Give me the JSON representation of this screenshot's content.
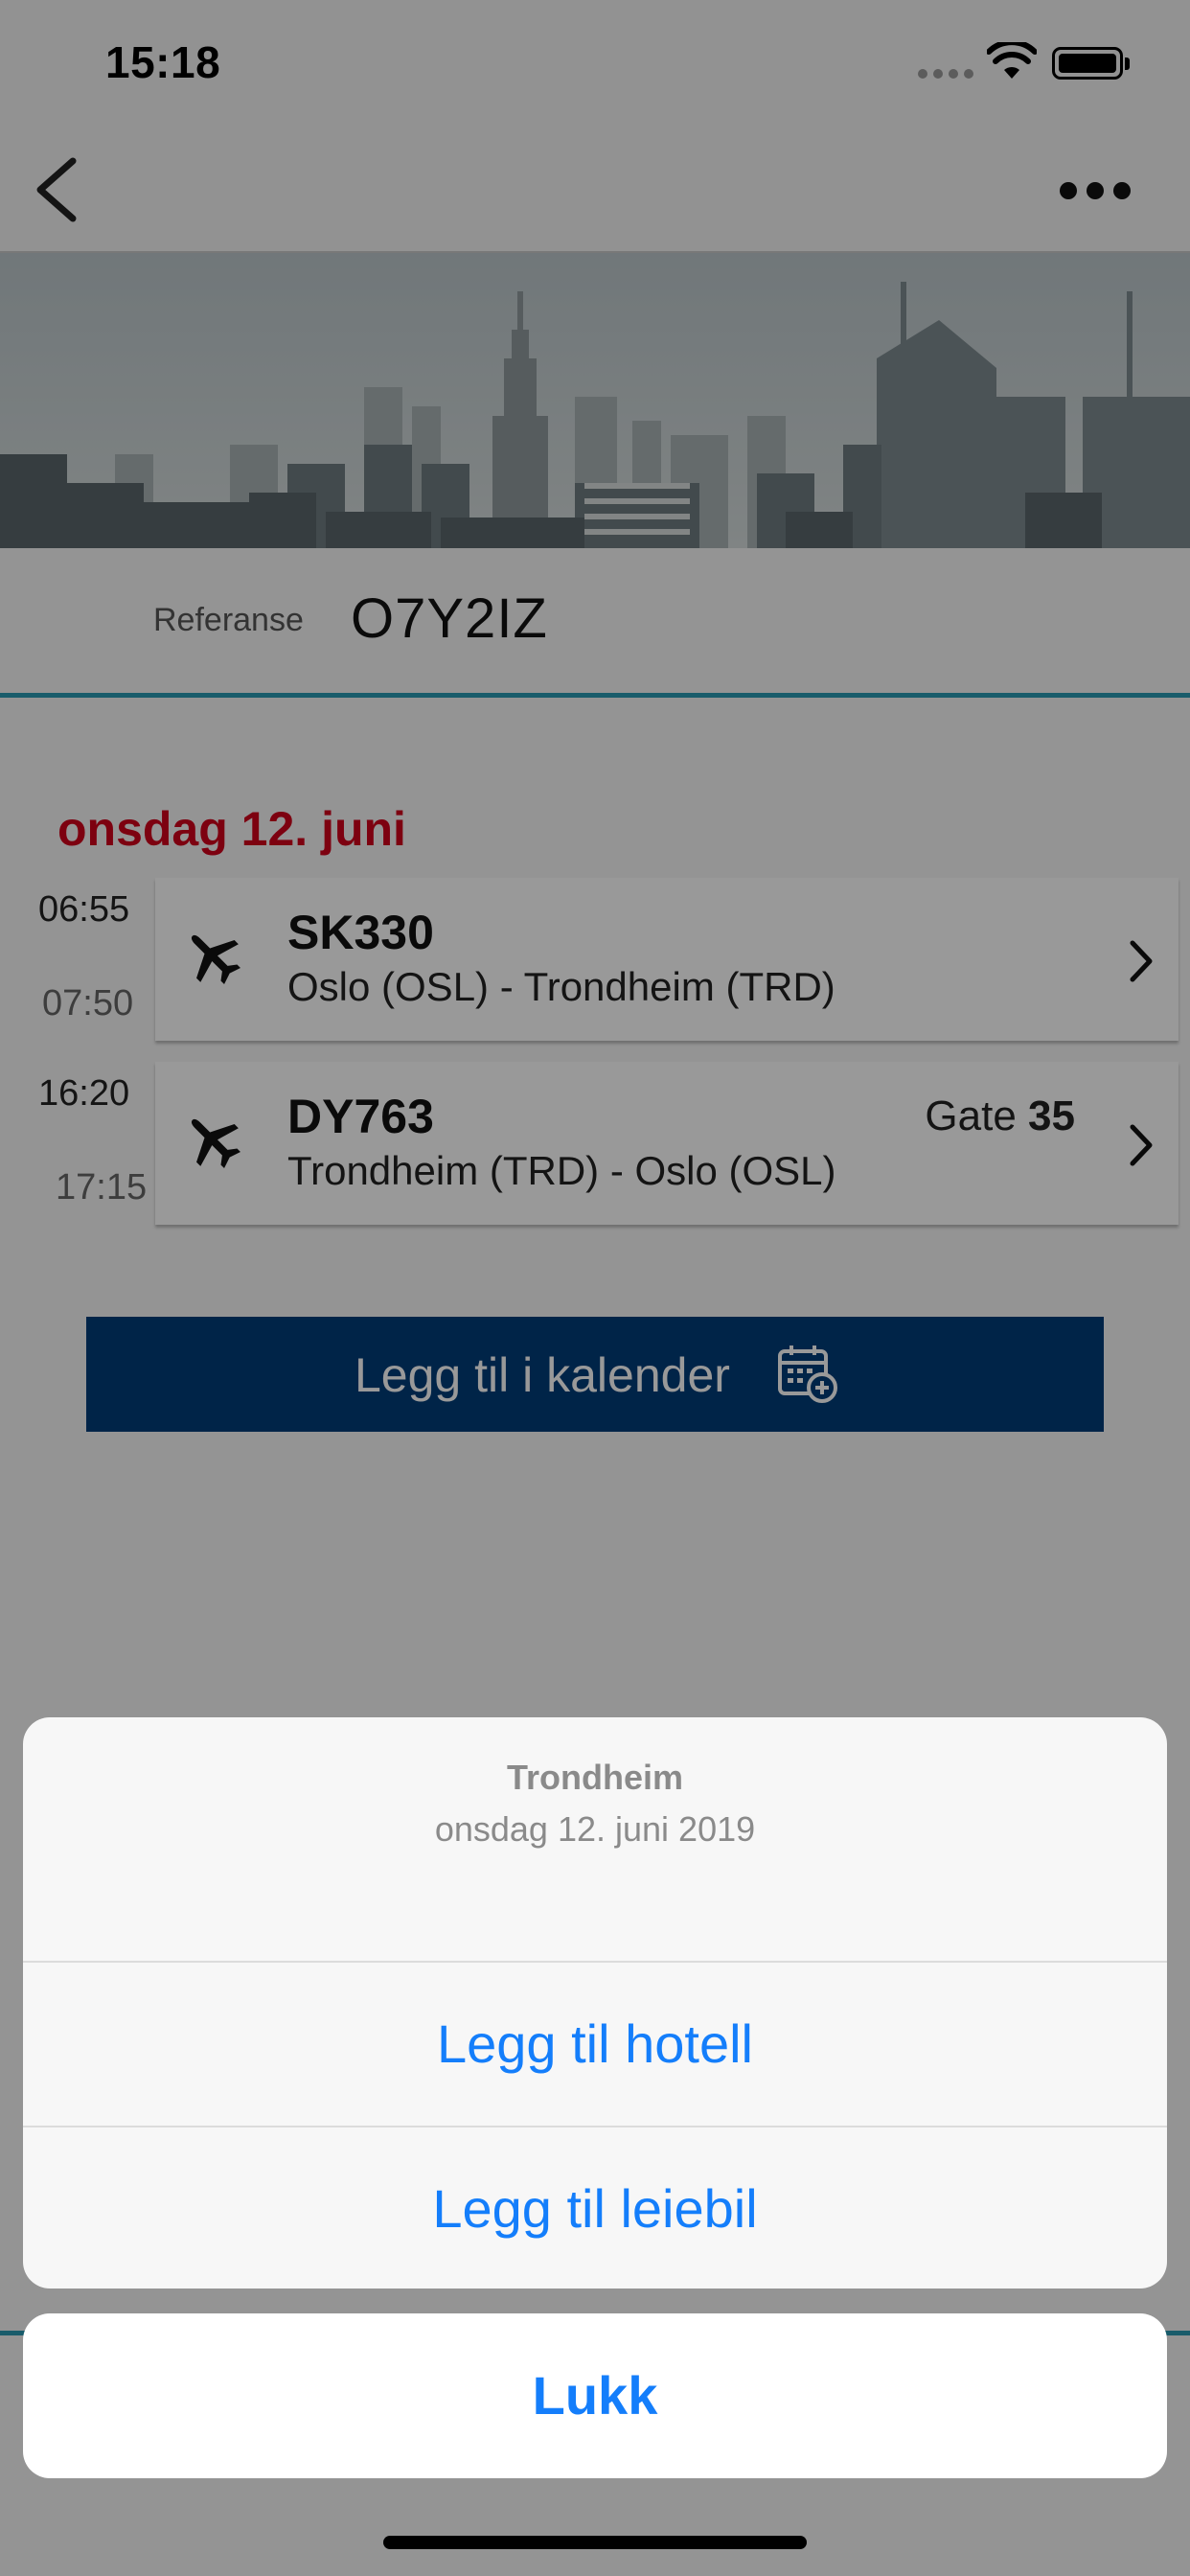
{
  "status_bar": {
    "time": "15:18"
  },
  "navbar": {
    "back_icon": "chevron-left-icon",
    "more_icon": "ellipsis-icon"
  },
  "booking": {
    "reference_label": "Referanse",
    "reference_value": "O7Y2IZ"
  },
  "day": {
    "date_label": "onsdag 12. juni",
    "flights": [
      {
        "departure": "06:55",
        "arrival": "07:50",
        "number": "SK330",
        "route": "Oslo (OSL) - Trondheim (TRD)",
        "gate_label": "",
        "gate_value": ""
      },
      {
        "departure": "16:20",
        "arrival": "17:15",
        "number": "DY763",
        "route": "Trondheim (TRD) - Oslo (OSL)",
        "gate_label": "Gate",
        "gate_value": "35"
      }
    ]
  },
  "calendar_button": {
    "label": "Legg til i kalender",
    "icon": "calendar-add-icon"
  },
  "action_sheet": {
    "title": "Trondheim",
    "subtitle": "onsdag 12. juni 2019",
    "actions": [
      "Legg til hotell",
      "Legg til leiebil"
    ],
    "cancel": "Lukk"
  },
  "colors": {
    "accent": "#147efb",
    "date_red": "#d0021b",
    "primary_button": "#003c78",
    "divider_teal": "#2b9ab3"
  }
}
